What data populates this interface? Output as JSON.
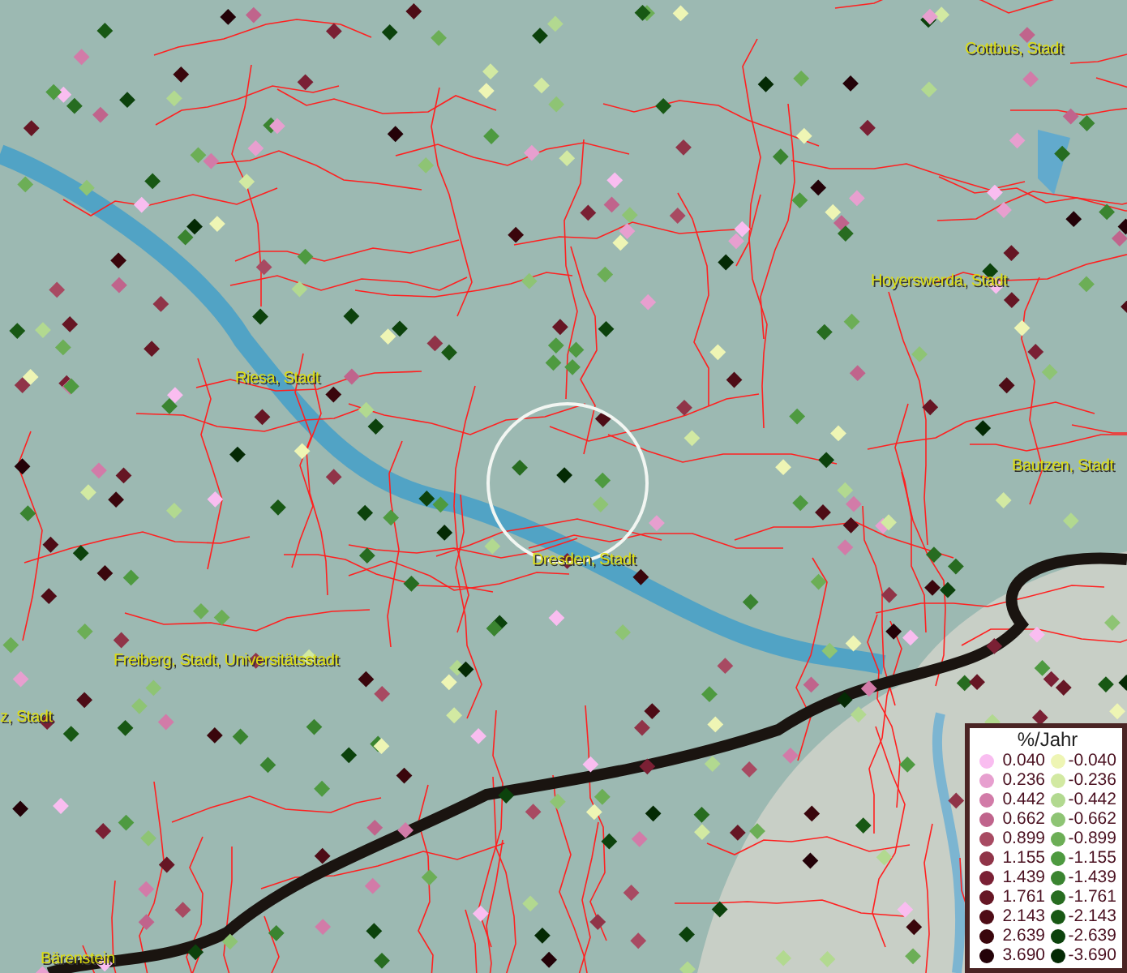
{
  "map": {
    "places": [
      {
        "name": "Cottbus, Stadt"
      },
      {
        "name": "Hoyerswerda, Stadt"
      },
      {
        "name": "Riesa, Stadt"
      },
      {
        "name": "Bautzen, Stadt"
      },
      {
        "name": "Dresden, Stadt"
      },
      {
        "name": "Freiberg, Stadt, Universitätsstadt"
      },
      {
        "name": "z, Stadt"
      },
      {
        "name": "Bärenstein"
      }
    ]
  },
  "legend": {
    "title": "%/Jahr",
    "columns": [
      [
        {
          "value": "0.040",
          "color": "#f9bdf0"
        },
        {
          "value": "0.236",
          "color": "#e79fcf"
        },
        {
          "value": "0.442",
          "color": "#d27ba8"
        },
        {
          "value": "0.662",
          "color": "#c0648c"
        },
        {
          "value": "0.899",
          "color": "#a84a62"
        },
        {
          "value": "1.155",
          "color": "#903448"
        },
        {
          "value": "1.439",
          "color": "#7a2034"
        },
        {
          "value": "1.761",
          "color": "#661624"
        },
        {
          "value": "2.143",
          "color": "#4e0c16"
        },
        {
          "value": "2.639",
          "color": "#3a060c"
        },
        {
          "value": "3.690",
          "color": "#240208"
        }
      ],
      [
        {
          "value": "-0.040",
          "color": "#eef5b4"
        },
        {
          "value": "-0.236",
          "color": "#d2e9a2"
        },
        {
          "value": "-0.442",
          "color": "#b2d990"
        },
        {
          "value": "-0.662",
          "color": "#8ec474"
        },
        {
          "value": "-0.899",
          "color": "#6cae56"
        },
        {
          "value": "-1.155",
          "color": "#4e9a40"
        },
        {
          "value": "-1.439",
          "color": "#3a8430"
        },
        {
          "value": "-1.761",
          "color": "#276c20"
        },
        {
          "value": "-2.143",
          "color": "#185814"
        },
        {
          "value": "-2.639",
          "color": "#0c420c"
        },
        {
          "value": "-3.690",
          "color": "#042a04"
        }
      ]
    ]
  }
}
